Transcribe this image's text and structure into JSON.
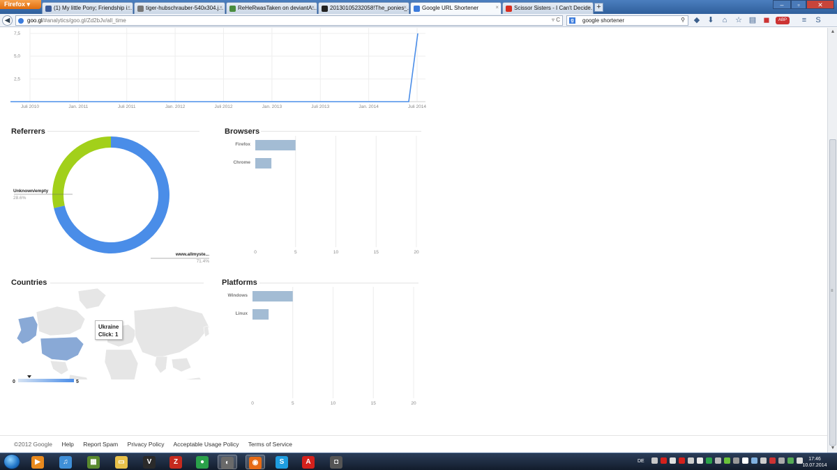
{
  "browser": {
    "menu_label": "Firefox",
    "tabs": [
      {
        "title": "(1) My little Pony; Friendship i...",
        "color": "#3a5a98"
      },
      {
        "title": "tiger-hubschrauber-540x304.j...",
        "color": "#777777"
      },
      {
        "title": "ReHeRwasTaken on deviantA...",
        "color": "#4a8d3f"
      },
      {
        "title": "20130105232058!The_ponies_...",
        "color": "#222222"
      },
      {
        "title": "Google URL Shortener",
        "color": "#3b7bdc"
      },
      {
        "title": "Scissor Sisters - I Can't Decide...",
        "color": "#d62d20"
      }
    ],
    "new_tab": "+",
    "close_glyph": "×",
    "window_buttons": [
      "–",
      "▫",
      "✕"
    ],
    "url_host": "goo.gl",
    "url_rest": "/#analytics/goo.gl/Zd2bJv/all_time",
    "url_actions": "▿ C",
    "search_engine": "g",
    "search_value": "google shortener",
    "search_go": "⚲",
    "toolbar_icons": [
      "◆",
      "⬇",
      "⌂",
      "☆",
      "▤",
      "◼",
      "ABP",
      "≡",
      "S"
    ]
  },
  "clicks_chart": {
    "type": "line",
    "x_ticks": [
      "Juli 2010",
      "Jan. 2011",
      "Juli 2011",
      "Jan. 2012",
      "Juli 2012",
      "Jan. 2013",
      "Juli 2013",
      "Jan. 2014",
      "Juli 2014"
    ],
    "y_ticks": [
      "7,5",
      "5,0",
      "2,5"
    ],
    "color": "#4a8de8"
  },
  "referrers": {
    "title": "Referrers",
    "chart_data": {
      "type": "pie",
      "slices": [
        {
          "label": "Unknown/empty",
          "value": 28.6,
          "percent": "28.6%",
          "color": "#a2d01a"
        },
        {
          "label": "www.allmyste...",
          "value": 71.4,
          "percent": "71.4%",
          "color": "#4a8de8"
        }
      ]
    }
  },
  "browsers": {
    "title": "Browsers",
    "chart_data": {
      "type": "bar",
      "categories": [
        "Firefox",
        "Chrome"
      ],
      "values": [
        5,
        2
      ],
      "xlim": [
        0,
        20
      ],
      "x_ticks": [
        "0",
        "5",
        "10",
        "15",
        "20"
      ],
      "color": "#a3bcd4"
    }
  },
  "countries": {
    "title": "Countries",
    "tooltip_country": "Ukraine",
    "tooltip_clicks": "Click: 1",
    "legend_min": "0",
    "legend_max": "5",
    "land_color": "#e6e6e6",
    "highlight_color": "#89a9d6"
  },
  "platforms": {
    "title": "Platforms",
    "chart_data": {
      "type": "bar",
      "categories": [
        "Windows",
        "Linux"
      ],
      "values": [
        5,
        2
      ],
      "xlim": [
        0,
        20
      ],
      "x_ticks": [
        "0",
        "5",
        "10",
        "15",
        "20"
      ],
      "color": "#a3bcd4"
    }
  },
  "footer": {
    "copyright": "©2012 Google",
    "links": [
      "Help",
      "Report Spam",
      "Privacy Policy",
      "Acceptable Usage Policy",
      "Terms of Service"
    ]
  },
  "taskbar": {
    "apps": [
      {
        "name": "media-player",
        "glyph": "▶",
        "color": "#e98a1e"
      },
      {
        "name": "itunes",
        "glyph": "♫",
        "color": "#3f8fd8"
      },
      {
        "name": "minecraft",
        "glyph": "▦",
        "color": "#5a8a2e"
      },
      {
        "name": "explorer",
        "glyph": "▭",
        "color": "#e8c14a"
      },
      {
        "name": "vnc",
        "glyph": "V",
        "color": "#2a2a2a"
      },
      {
        "name": "filezilla",
        "glyph": "Z",
        "color": "#c62a1e"
      },
      {
        "name": "games",
        "glyph": "●",
        "color": "#2aa14a"
      },
      {
        "name": "network",
        "glyph": "◐",
        "color": "#6a6a6a"
      },
      {
        "name": "firefox",
        "glyph": "◉",
        "color": "#e66a15"
      },
      {
        "name": "skype",
        "glyph": "S",
        "color": "#1e9de0"
      },
      {
        "name": "avira",
        "glyph": "A",
        "color": "#d4211c"
      },
      {
        "name": "camera",
        "glyph": "◘",
        "color": "#555555"
      }
    ],
    "language": "DE",
    "time": "17:46",
    "date": "10.07.2014",
    "tray_colors": [
      "#c8c8c8",
      "#d4211c",
      "#e0e0e0",
      "#d4211c",
      "#cccccc",
      "#e8e8e8",
      "#2aa14a",
      "#bbbbbb",
      "#6ac23a",
      "#999999",
      "#ffffff",
      "#7fb0e0",
      "#cccccc",
      "#cc3333",
      "#aaaaaa",
      "#55aa55",
      "#dddddd"
    ]
  }
}
